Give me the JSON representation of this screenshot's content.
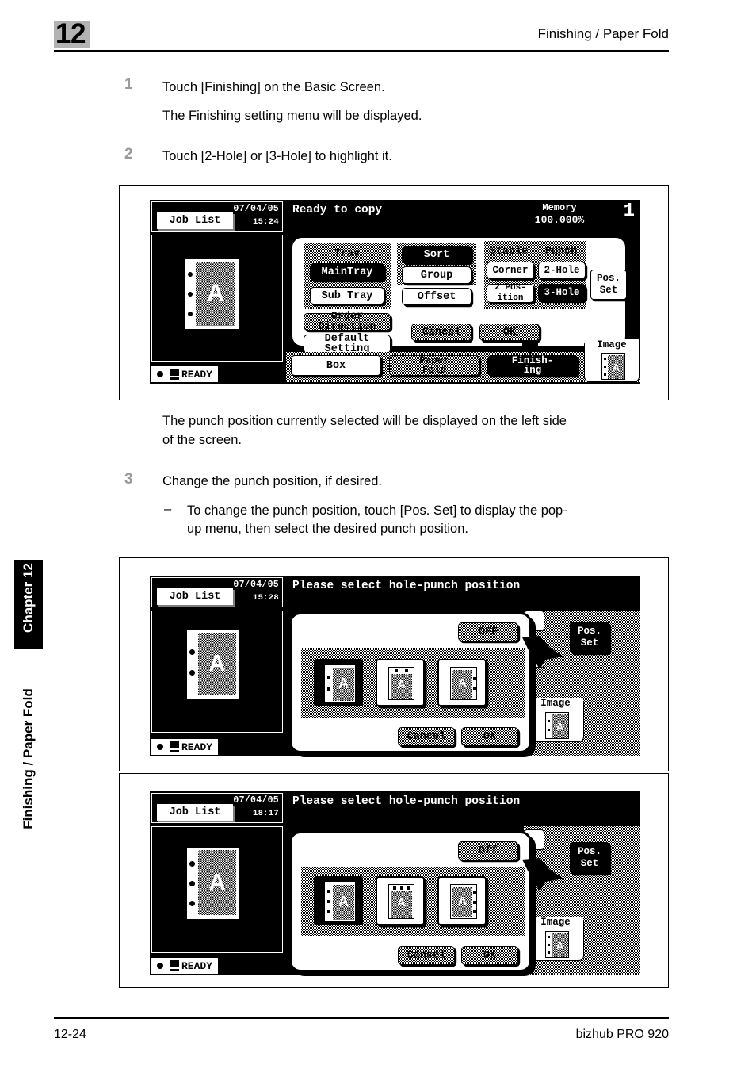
{
  "header": {
    "chapter_number": "12",
    "title": "Finishing / Paper Fold"
  },
  "sidebar": {
    "chapter_tab": "Chapter 12",
    "section_tab": "Finishing / Paper Fold"
  },
  "footer": {
    "page_number": "12-24",
    "product": "bizhub PRO 920"
  },
  "steps": [
    {
      "number": "1",
      "text": "Touch [Finishing] on the Basic Screen.",
      "note": "The Finishing setting menu will be displayed."
    },
    {
      "number": "2",
      "text": "Touch [2-Hole] or [3-Hole] to highlight it."
    },
    {
      "number": "3",
      "text": "Change the punch position, if desired.",
      "bullet_dash": "–",
      "bullet_line1": "To change the punch position, touch [Pos. Set] to display the pop-",
      "bullet_line2": "up menu, then select the desired punch position."
    }
  ],
  "after_figure1": {
    "line1": "The punch position currently selected will be displayed on the left side",
    "line2": "of the screen."
  },
  "screen1": {
    "job_list": "Job List",
    "date": "07/04/05",
    "time": "15:24",
    "message": "Ready to copy",
    "memory_label": "Memory",
    "memory_value": "100.000%",
    "copy_count": "1",
    "ready_status": "READY",
    "tray_label": "Tray",
    "main_tray": "MainTray",
    "sub_tray": "Sub Tray",
    "order_direction": "Order\nDirection",
    "default_setting": "Default\nSetting",
    "sort": "Sort",
    "group": "Group",
    "offset": "Offset",
    "staple_label": "Staple",
    "punch_label": "Punch",
    "corner": "Corner",
    "two_position": "2 Pos-\nition",
    "two_hole": "2-Hole",
    "three_hole": "3-Hole",
    "pos_set": "Pos.\nSet",
    "cancel": "Cancel",
    "ok": "OK",
    "tab_box": "Box",
    "tab_paper_fold": "Paper\nFold",
    "tab_finishing": "Finish-\ning",
    "image_label": "Image",
    "selected": [
      "MainTray",
      "Sort",
      "3-Hole",
      "Finishing"
    ],
    "preview_holes": 3
  },
  "screen2": {
    "job_list": "Job List",
    "date": "07/04/05",
    "time": "15:28",
    "message": "Please select hole-punch position",
    "ready_status": "READY",
    "off_button": "OFF",
    "pos_set": "Pos.\nSet",
    "cancel": "Cancel",
    "ok": "OK",
    "image_label": "Image",
    "punch_options": [
      "left",
      "top",
      "right"
    ],
    "selected_option": "left",
    "holes": 2,
    "preview_holes": 2
  },
  "screen3": {
    "job_list": "Job List",
    "date": "07/04/05",
    "time": "18:17",
    "message": "Please select hole-punch position",
    "ready_status": "READY",
    "off_button": "Off",
    "pos_set": "Pos.\nSet",
    "cancel": "Cancel",
    "ok": "OK",
    "image_label": "Image",
    "punch_options": [
      "left",
      "top",
      "right"
    ],
    "selected_option": "left",
    "holes": 3,
    "preview_holes": 3
  },
  "colors": {
    "badge_gray": "#b3b3b3",
    "step_number_gray": "#9a9a9a",
    "lcd_background": "#000000",
    "lcd_foreground": "#ffffff"
  }
}
